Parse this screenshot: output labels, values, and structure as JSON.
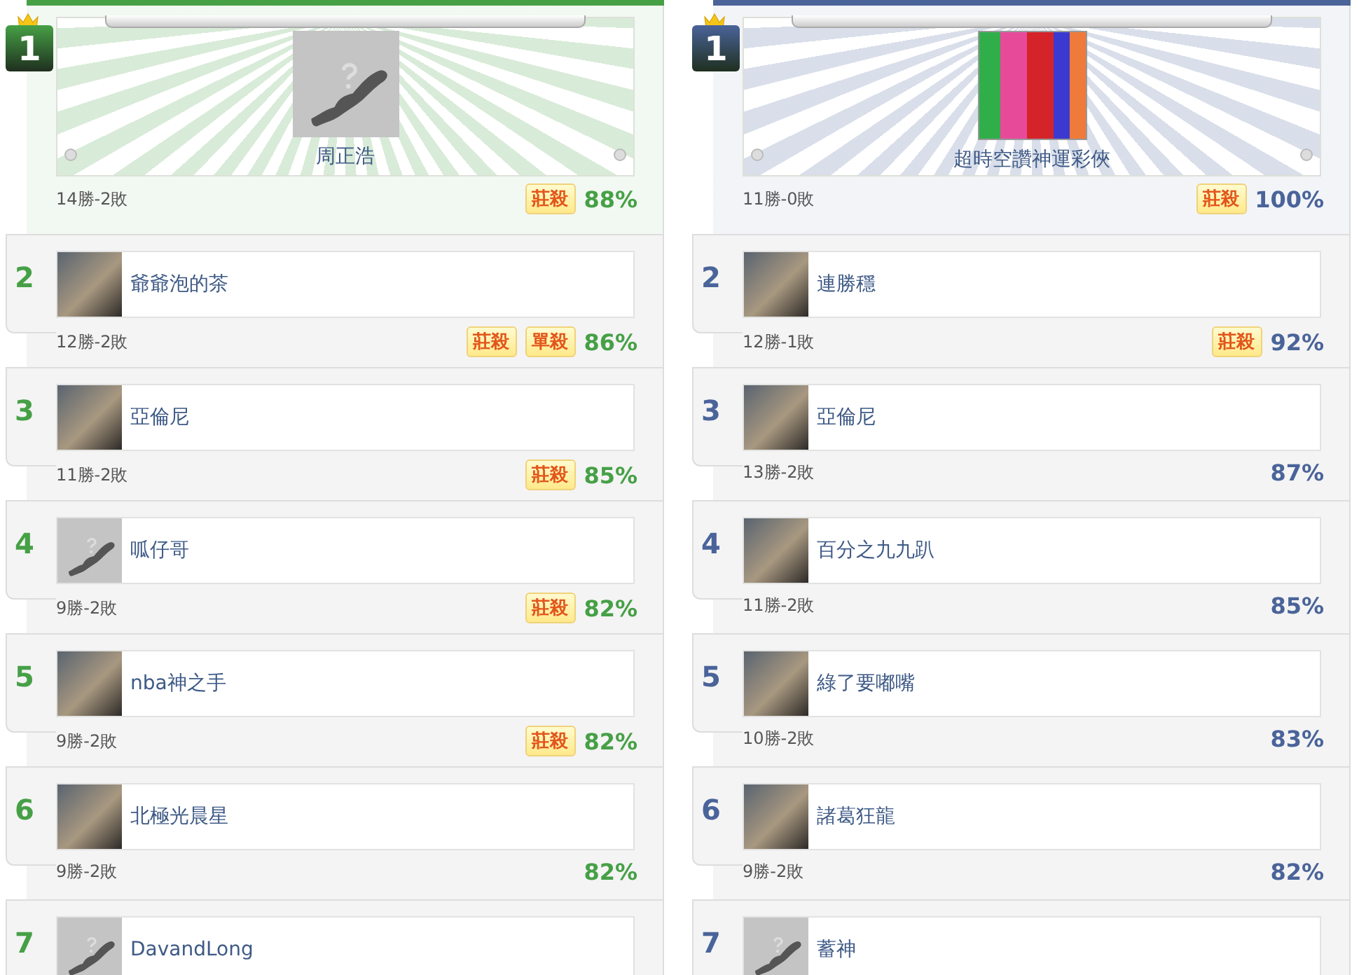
{
  "panels": [
    {
      "color": "#46a046",
      "top": {
        "rank": "1",
        "name": "周正浩",
        "kind": "default",
        "record": "14勝-2敗",
        "tags": [
          "莊殺"
        ],
        "percent": "88%"
      },
      "rows": [
        {
          "rank": "2",
          "name": "爺爺泡的茶",
          "kind": "photo",
          "record": "12勝-2敗",
          "tags": [
            "莊殺",
            "單殺"
          ],
          "percent": "86%"
        },
        {
          "rank": "3",
          "name": "亞倫尼",
          "kind": "photo",
          "record": "11勝-2敗",
          "tags": [
            "莊殺"
          ],
          "percent": "85%"
        },
        {
          "rank": "4",
          "name": "呱仔哥",
          "kind": "default",
          "record": "9勝-2敗",
          "tags": [
            "莊殺"
          ],
          "percent": "82%"
        },
        {
          "rank": "5",
          "name": "nba神之手",
          "kind": "photo",
          "record": "9勝-2敗",
          "tags": [
            "莊殺"
          ],
          "percent": "82%"
        },
        {
          "rank": "6",
          "name": "北極光晨星",
          "kind": "photo",
          "record": "9勝-2敗",
          "tags": [],
          "percent": "82%"
        },
        {
          "rank": "7",
          "name": "DavandLong",
          "kind": "default"
        }
      ]
    },
    {
      "color": "#4a649a",
      "top": {
        "rank": "1",
        "name": "超時空讚神運彩俠",
        "kind": "photo",
        "record": "11勝-0敗",
        "tags": [
          "莊殺"
        ],
        "percent": "100%"
      },
      "rows": [
        {
          "rank": "2",
          "name": "連勝穩",
          "kind": "photo",
          "record": "12勝-1敗",
          "tags": [
            "莊殺"
          ],
          "percent": "92%"
        },
        {
          "rank": "3",
          "name": "亞倫尼",
          "kind": "photo",
          "record": "13勝-2敗",
          "tags": [],
          "percent": "87%"
        },
        {
          "rank": "4",
          "name": "百分之九九趴",
          "kind": "photo",
          "record": "11勝-2敗",
          "tags": [],
          "percent": "85%"
        },
        {
          "rank": "5",
          "name": "綠了要嘟嘴",
          "kind": "photo",
          "record": "10勝-2敗",
          "tags": [],
          "percent": "83%"
        },
        {
          "rank": "6",
          "name": "諸葛狂龍",
          "kind": "photo",
          "record": "9勝-2敗",
          "tags": [],
          "percent": "82%"
        },
        {
          "rank": "7",
          "name": "蓄神",
          "kind": "default"
        }
      ]
    }
  ]
}
